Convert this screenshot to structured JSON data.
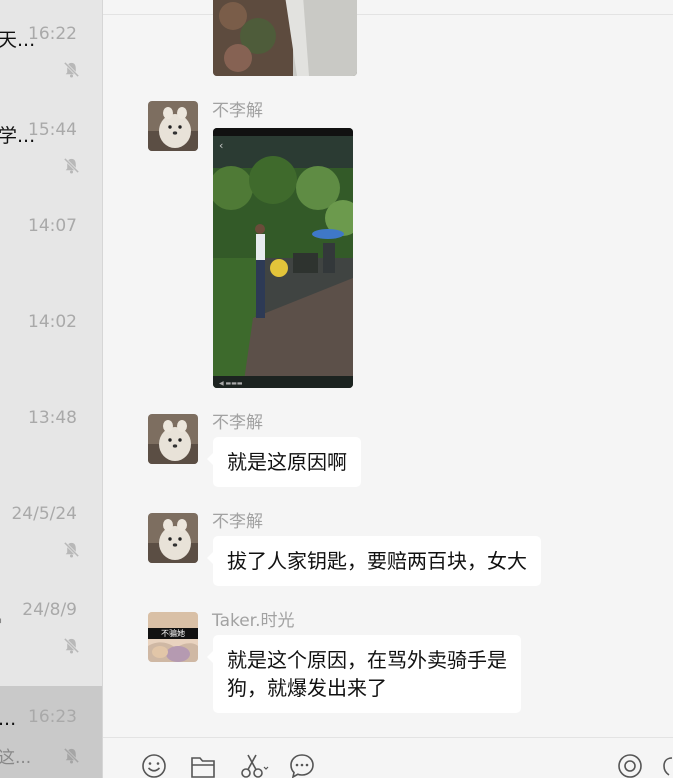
{
  "sidebar": {
    "conversations": [
      {
        "snippet": "天...",
        "time": "16:22",
        "muted": true,
        "selected": false
      },
      {
        "snippet": "学...",
        "time": "15:44",
        "muted": true,
        "selected": false
      },
      {
        "snippet": "",
        "time": "14:07",
        "muted": false,
        "selected": false
      },
      {
        "snippet": "",
        "time": "14:02",
        "muted": false,
        "selected": false
      },
      {
        "snippet": "",
        "time": "13:48",
        "muted": false,
        "selected": false
      },
      {
        "snippet": "",
        "time": "24/5/24",
        "muted": true,
        "selected": false
      },
      {
        "snippet": "",
        "time": "24/8/9",
        "muted": true,
        "selected": false
      },
      {
        "snippet": "...",
        "snippet2": "这...",
        "time": "16:23",
        "muted": true,
        "selected": true
      }
    ]
  },
  "chat": {
    "messages": [
      {
        "sender": "不李解",
        "type": "image",
        "image": "phone-screenshot-street"
      },
      {
        "sender": "不李解",
        "type": "text",
        "text": "就是这原因啊"
      },
      {
        "sender": "不李解",
        "type": "text",
        "text": "拔了人家钥匙，要赔两百块，女大"
      },
      {
        "sender": "Taker.时光",
        "type": "text",
        "text_lines": [
          "就是这个原因，在骂外卖骑手是",
          "狗，就爆发出来了"
        ]
      }
    ],
    "taker_avatar_caption": "不骗她"
  },
  "toolbar": {
    "icons": [
      "emoji-icon",
      "folder-icon",
      "scissors-icon",
      "chat-bubble-icon",
      "video-call-icon",
      "voice-call-icon"
    ]
  },
  "colors": {
    "bubble": "#ffffff",
    "background": "#f5f5f5",
    "sidebar": "#e6e6e6",
    "selected": "#c9c9c9"
  }
}
